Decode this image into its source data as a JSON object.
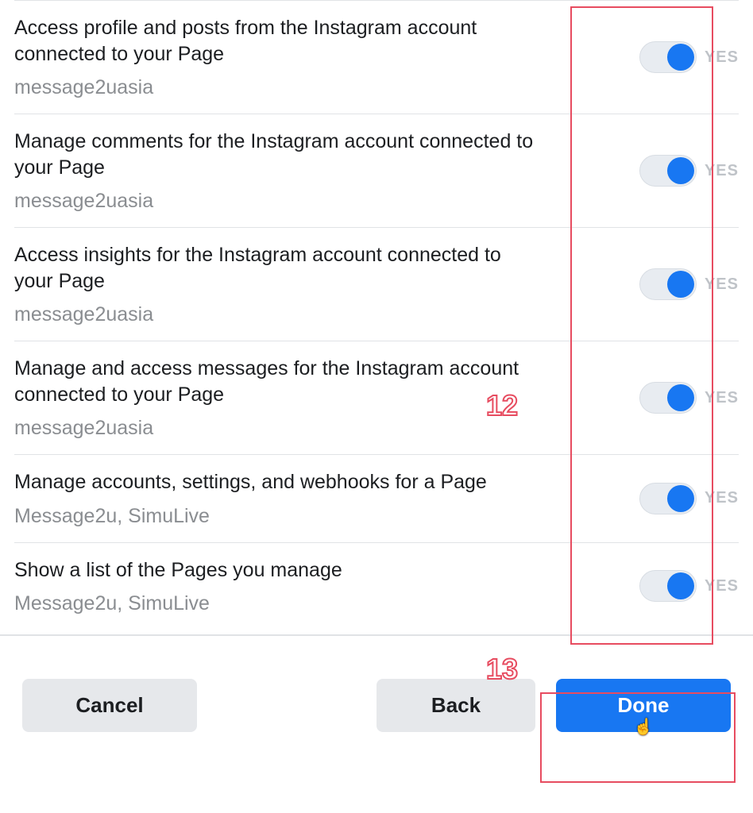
{
  "permissions": [
    {
      "title": "Access profile and posts from the Instagram account connected to your Page",
      "subtitle": "message2uasia",
      "state": "YES"
    },
    {
      "title": "Manage comments for the Instagram account connected to your Page",
      "subtitle": "message2uasia",
      "state": "YES"
    },
    {
      "title": "Access insights for the Instagram account connected to your Page",
      "subtitle": "message2uasia",
      "state": "YES"
    },
    {
      "title": "Manage and access messages for the Instagram account connected to your Page",
      "subtitle": "message2uasia",
      "state": "YES"
    },
    {
      "title": "Manage accounts, settings, and webhooks for a Page",
      "subtitle": "Message2u, SimuLive",
      "state": "YES"
    },
    {
      "title": "Show a list of the Pages you manage",
      "subtitle": "Message2u, SimuLive",
      "state": "YES"
    }
  ],
  "buttons": {
    "cancel": "Cancel",
    "back": "Back",
    "done": "Done"
  },
  "annotations": {
    "step12": "12",
    "step13": "13"
  }
}
